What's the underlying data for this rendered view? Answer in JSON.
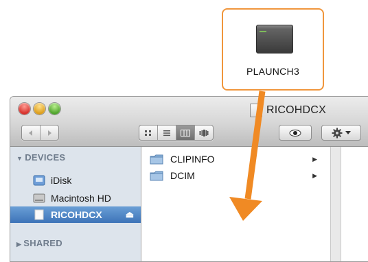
{
  "callout": {
    "app_label": "PLAUNCH3"
  },
  "window": {
    "title": "RICOHDCX",
    "toolbar": {
      "nav_icons": [
        "back-arrow-icon",
        "forward-arrow-icon"
      ],
      "view_icons": [
        "icon-view-icon",
        "list-view-icon",
        "column-view-icon",
        "coverflow-view-icon"
      ],
      "active_view": "column-view-icon",
      "quicklook_icon": "eye-icon",
      "action_icon": "gear-icon"
    },
    "sidebar": {
      "devices_header": "DEVICES",
      "items": [
        {
          "label": "iDisk",
          "icon": "idisk-icon"
        },
        {
          "label": "Macintosh HD",
          "icon": "hard-drive-icon"
        },
        {
          "label": "RICOHDCX",
          "icon": "volume-icon",
          "selected": true
        }
      ],
      "shared_header": "SHARED"
    },
    "column": {
      "items": [
        {
          "label": "CLIPINFO",
          "icon": "folder-icon"
        },
        {
          "label": "DCIM",
          "icon": "folder-icon"
        }
      ]
    }
  },
  "accent_colors": {
    "callout_border": "#f0963c",
    "arrow": "#f08a24",
    "selection": "#3d73b8"
  }
}
